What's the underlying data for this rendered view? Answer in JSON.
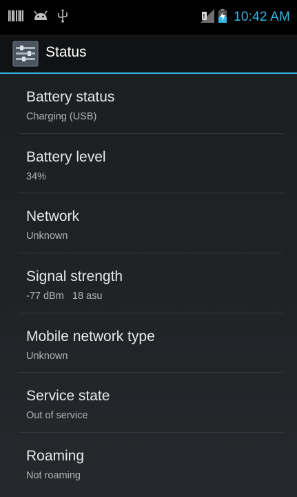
{
  "status_bar": {
    "time": "10:42 AM",
    "left_icons": [
      "barcode-icon",
      "android-debug-icon",
      "usb-icon"
    ],
    "right_icons": [
      "no-signal-icon",
      "battery-charging-icon"
    ]
  },
  "action_bar": {
    "title": "Status",
    "icon": "settings-app-icon"
  },
  "items": [
    {
      "title": "Battery status",
      "value": "Charging (USB)"
    },
    {
      "title": "Battery level",
      "value": "34%"
    },
    {
      "title": "Network",
      "value": "Unknown"
    },
    {
      "title": "Signal strength",
      "value": "-77 dBm   18 asu"
    },
    {
      "title": "Mobile network type",
      "value": "Unknown"
    },
    {
      "title": "Service state",
      "value": "Out of service"
    },
    {
      "title": "Roaming",
      "value": "Not roaming"
    }
  ],
  "colors": {
    "accent": "#33b5e5",
    "background": "#1e2124",
    "title_text": "#e8e8e8",
    "summary_text": "#b3b3b3"
  }
}
